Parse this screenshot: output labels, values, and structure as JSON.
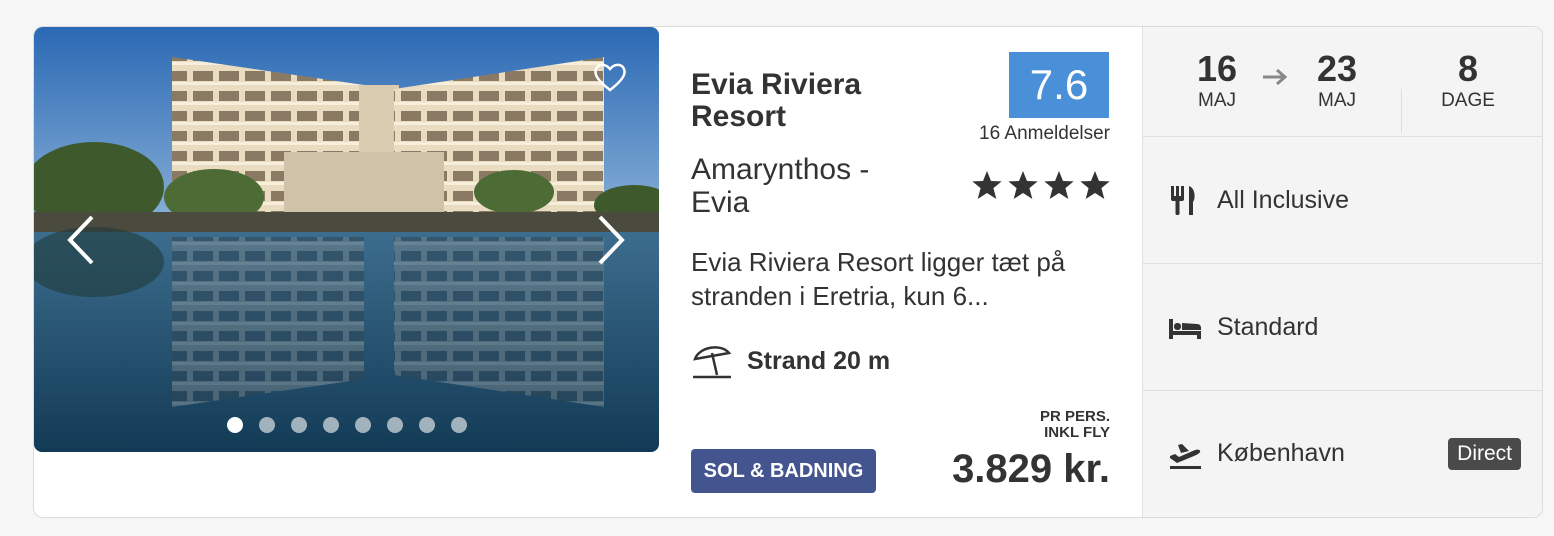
{
  "hotel": {
    "name": "Evia Riviera Resort",
    "location": "Amarynthos - Evia",
    "stars": 4,
    "description": "Evia Riviera Resort ligger tæt på stranden i Eretria, kun 6...",
    "beach_distance": "Strand 20 m"
  },
  "rating": {
    "score": "7.6",
    "reviews": "16 Anmeldelser",
    "color": "#4a90d9"
  },
  "gallery": {
    "image_count": 8,
    "active_index": 0,
    "prev_icon": "chevron-left-icon",
    "next_icon": "chevron-right-icon",
    "favorite_icon": "heart-icon"
  },
  "theme_tag": {
    "label": "SOL & BADNING",
    "color": "#43548f"
  },
  "price": {
    "caption_line1": "PR PERS.",
    "caption_line2": "INKL FLY",
    "amount": "3.829 kr."
  },
  "trip": {
    "depart_day": "16",
    "depart_month": "MAJ",
    "return_day": "23",
    "return_month": "MAJ",
    "duration_num": "8",
    "duration_label": "DAGE"
  },
  "details": {
    "board": "All Inclusive",
    "board_icon": "cutlery-icon",
    "room": "Standard",
    "room_icon": "bed-icon",
    "departure_airport": "København",
    "flight_icon": "plane-departure-icon",
    "flight_type": "Direct"
  }
}
